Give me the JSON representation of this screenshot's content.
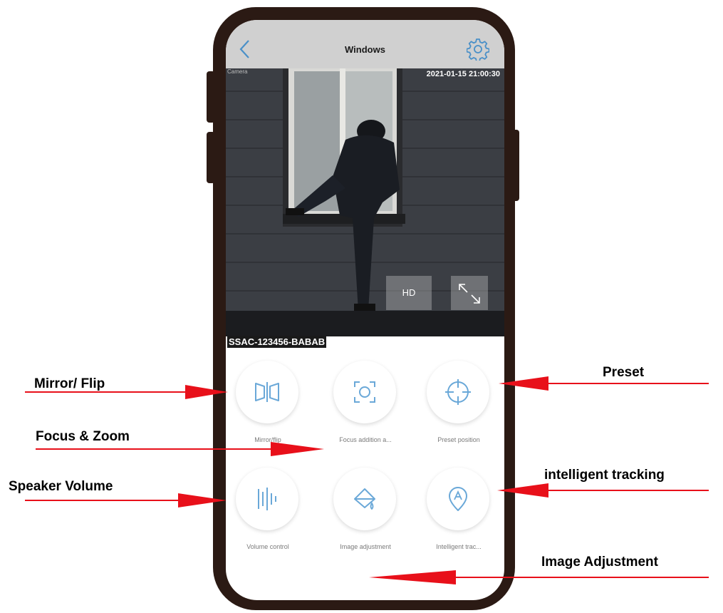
{
  "app": {
    "title": "Windows",
    "camera_label": "Camera",
    "timestamp": "2021-01-15 21:00:30",
    "hd_label": "HD",
    "device_id": "SSAC-123456-BABAB"
  },
  "controls": [
    {
      "label": "Mirror/flip",
      "icon": "mirror-flip-icon"
    },
    {
      "label": "Focus addition a...",
      "icon": "focus-zoom-icon"
    },
    {
      "label": "Preset position",
      "icon": "crosshair-icon"
    },
    {
      "label": "Volume control",
      "icon": "volume-bars-icon"
    },
    {
      "label": "Image adjustment",
      "icon": "paint-bucket-icon"
    },
    {
      "label": "Intelligent trac...",
      "icon": "location-pin-icon"
    }
  ],
  "annotations": {
    "mirror": "Mirror/ Flip",
    "focus": "Focus & Zoom",
    "speaker": "Speaker Volume",
    "preset": "Preset",
    "tracking": "intelligent tracking",
    "image": "Image Adjustment"
  },
  "colors": {
    "frame": "#2b1a14",
    "accent": "#6aa8d8",
    "arrow": "#e8101a"
  }
}
